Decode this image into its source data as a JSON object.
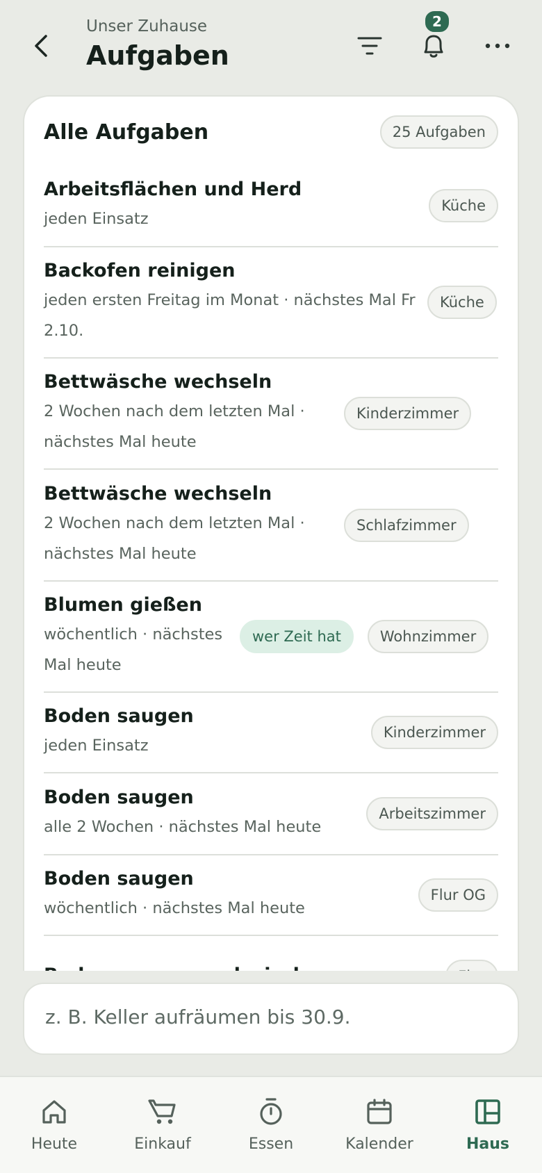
{
  "header": {
    "subtitle": "Unser Zuhause",
    "title": "Aufgaben",
    "notification_count": "2",
    "icons": [
      "back-icon",
      "filter-icon",
      "bell-icon",
      "more-icon"
    ]
  },
  "card": {
    "title": "Alle Aufgaben",
    "count": "25 Aufgaben"
  },
  "tasks": [
    {
      "title": "Arbeitsflächen und Herd",
      "subtitle": "jeden Einsatz",
      "chips": [
        "Küche"
      ]
    },
    {
      "title": "Backofen reinigen",
      "subtitle": "jeden ersten Freitag im Monat · nächstes Mal Fr 2.10.",
      "chips": [
        "Küche"
      ]
    },
    {
      "title": "Bettwäsche wechseln",
      "subtitle": "2 Wochen nach dem letzten Mal · nächstes Mal heute",
      "chips": [
        "Kinderzimmer"
      ]
    },
    {
      "title": "Bettwäsche wechseln",
      "subtitle": "2 Wochen nach dem letzten Mal · nächstes Mal heute",
      "chips": [
        "Schlafzimmer"
      ]
    },
    {
      "title": "Blumen gießen",
      "subtitle": "wöchentlich · nächstes Mal heute",
      "assignee": "wer Zeit hat",
      "chips": [
        "Wohnzimmer"
      ]
    },
    {
      "title": "Boden saugen",
      "subtitle": "jeden Einsatz",
      "chips": [
        "Kinderzimmer"
      ]
    },
    {
      "title": "Boden saugen",
      "subtitle": "alle 2 Wochen · nächstes Mal heute",
      "chips": [
        "Arbeitszimmer"
      ]
    },
    {
      "title": "Boden saugen",
      "subtitle": "wöchentlich · nächstes Mal heute",
      "chips": [
        "Flur OG"
      ]
    },
    {
      "title": "Boden saugen und wischen",
      "subtitle": "",
      "chips": [
        "Flur"
      ]
    }
  ],
  "input": {
    "placeholder": "z. B. Keller aufräumen bis 30.9.",
    "value": ""
  },
  "nav": [
    {
      "label": "Heute",
      "icon": "home-icon"
    },
    {
      "label": "Einkauf",
      "icon": "cart-icon"
    },
    {
      "label": "Essen",
      "icon": "timer-icon"
    },
    {
      "label": "Kalender",
      "icon": "calendar-icon"
    },
    {
      "label": "Haus",
      "icon": "layout-icon"
    }
  ],
  "colors": {
    "accent": "#2e6a52",
    "background": "#e9ebe6",
    "card": "#ffffff",
    "green_chip": "#dcefe5"
  }
}
